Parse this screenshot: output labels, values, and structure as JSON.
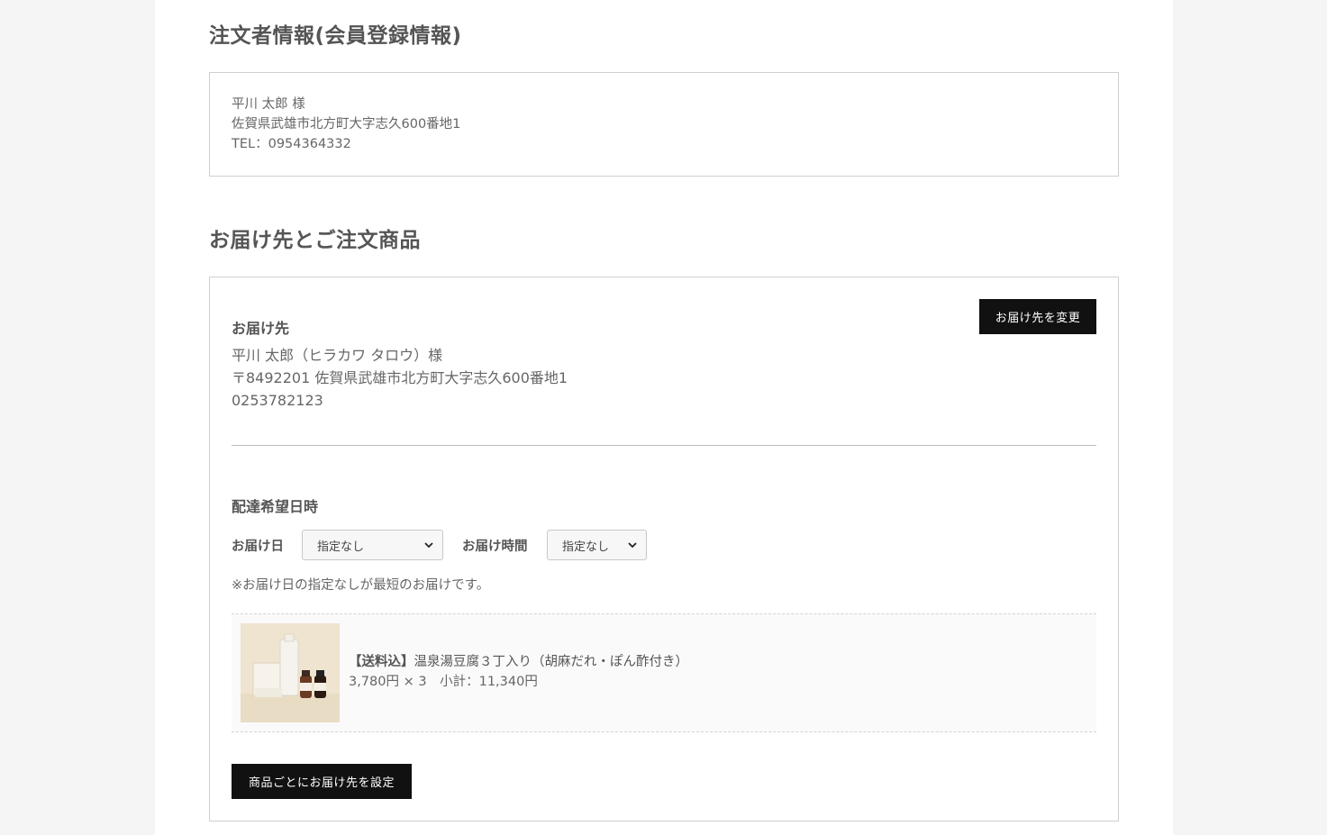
{
  "orderer": {
    "title": "注文者情報(会員登録情報)",
    "name": "平川 太郎 様",
    "address": "佐賀県武雄市北方町大字志久600番地1",
    "tel": "TEL：0954364332"
  },
  "delivery": {
    "title": "お届け先とご注文商品",
    "dest_title": "お届け先",
    "change_button": "お届け先を変更",
    "name": "平川 太郎（ヒラカワ タロウ）様",
    "address": "〒8492201 佐賀県武雄市北方町大字志久600番地1",
    "phone": "0253782123",
    "datetime_title": "配達希望日時",
    "date_label": "お届け日",
    "date_value": "指定なし",
    "time_label": "お届け時間",
    "time_value": "指定なし",
    "note": "※お届け日の指定なしが最短のお届けです。",
    "multi_button": "商品ごとにお届け先を設定"
  },
  "product": {
    "tag": "【送料込】",
    "name": "温泉湯豆腐３丁入り（胡麻だれ・ぽん酢付き）",
    "price_line": "3,780円 × 3　小計：11,340円"
  },
  "colors": {
    "button_bg": "#111111",
    "page_bg": "#f5f5f5"
  }
}
